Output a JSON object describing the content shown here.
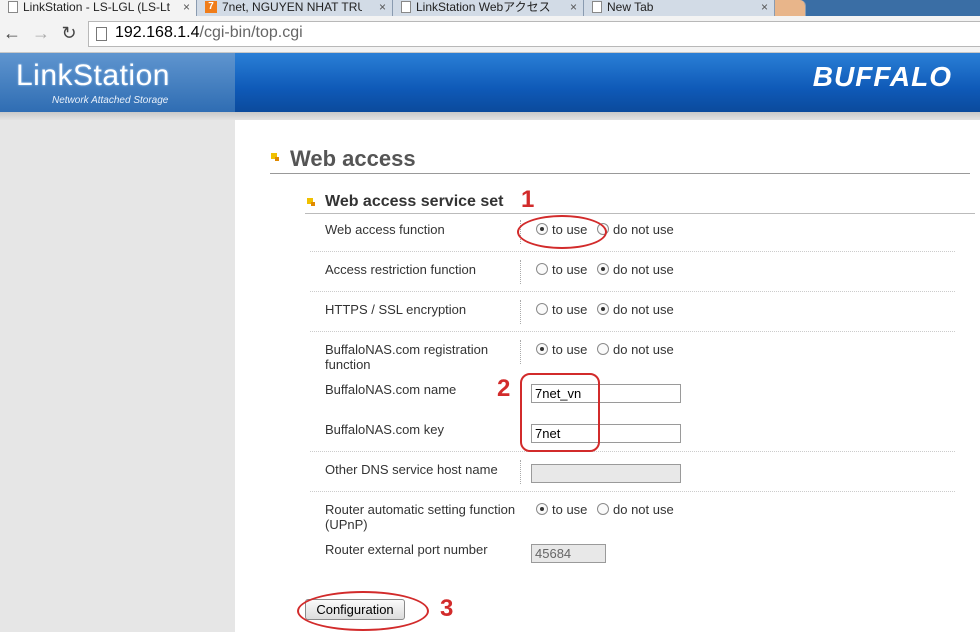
{
  "browser": {
    "tabs": [
      {
        "title": "LinkStation - LS-LGL (LS-Lt",
        "close": "×",
        "icon": "page-icon"
      },
      {
        "title": "7net, NGUYEN NHAT TRU",
        "close": "×",
        "icon": "7net-favicon"
      },
      {
        "title": "LinkStation Webアクセス",
        "close": "×",
        "icon": "page-icon"
      },
      {
        "title": "New Tab",
        "close": "×",
        "icon": "page-icon"
      }
    ],
    "back": "←",
    "forward": "→",
    "reload": "↻",
    "url_host": "192.168.1.4",
    "url_path": "/cgi-bin/top.cgi"
  },
  "header": {
    "logo": "LinkStation",
    "logo_sub": "Network Attached Storage",
    "brand": "BUFFALO"
  },
  "page": {
    "title": "Web access",
    "section": "Web access service set"
  },
  "options": {
    "use": "to use",
    "not_use": "do not use"
  },
  "settings": {
    "web_access": {
      "label": "Web access function",
      "value": "to use"
    },
    "access_restriction": {
      "label": "Access restriction function",
      "value": "do not use"
    },
    "https_ssl": {
      "label": "HTTPS / SSL encryption",
      "value": "do not use"
    },
    "registration": {
      "label": "BuffaloNAS.com registration function",
      "value": "to use"
    },
    "nas_name": {
      "label": "BuffaloNAS.com name",
      "value": "7net_vn"
    },
    "nas_key": {
      "label": "BuffaloNAS.com key",
      "value": "7net"
    },
    "dns_host": {
      "label": "Other DNS service host name",
      "value": ""
    },
    "upnp": {
      "label": "Router automatic setting function (UPnP)",
      "value": "to use"
    },
    "ext_port": {
      "label": "Router external port number",
      "value": "45684"
    }
  },
  "button": {
    "configuration": "Configuration"
  },
  "annotations": {
    "step1": "1",
    "step2": "2",
    "step3": "3",
    "color": "#d22b2b"
  },
  "colors": {
    "header_blue": "#0f5ab8",
    "bullet_yellow": "#f0c000"
  }
}
